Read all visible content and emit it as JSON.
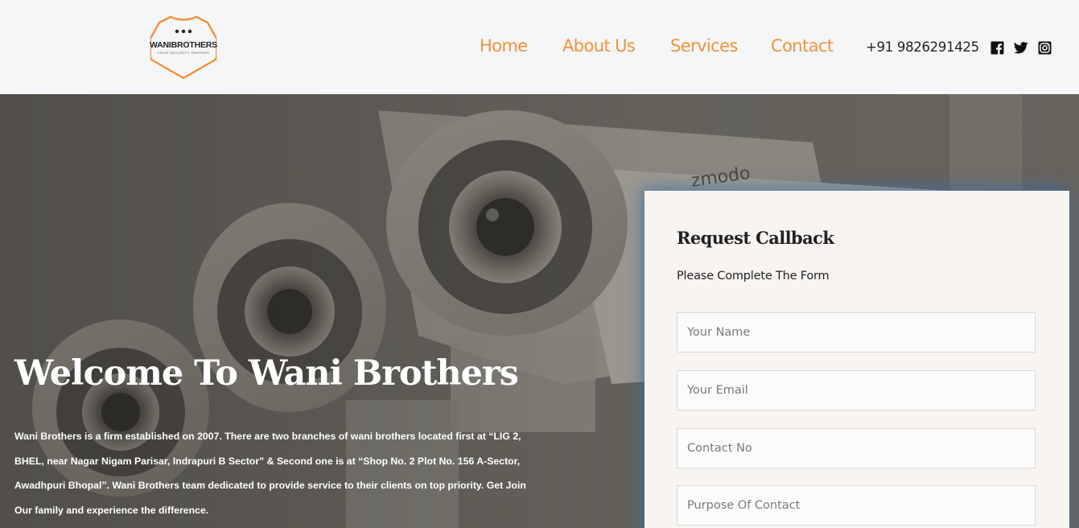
{
  "brand": {
    "name": "WANIBROTHERS",
    "tagline": "YOUR SECURITY PARTNER",
    "accent_color": "#f2913b"
  },
  "nav": {
    "items": [
      {
        "label": "Home"
      },
      {
        "label": "About Us"
      },
      {
        "label": "Services"
      },
      {
        "label": "Contact"
      }
    ],
    "phone": "+91 9826291425",
    "social_icons": [
      "facebook-icon",
      "twitter-icon",
      "instagram-icon"
    ]
  },
  "hero": {
    "title": "Welcome To Wani Brothers",
    "description": "Wani Brothers is a firm established on 2007. There are two branches of wani brothers located first at “LIG 2, BHEL, near Nagar Nigam Parisar, Indrapuri B Sector” & Second one is at “Shop No. 2 Plot No. 156 A-Sector, Awadhpuri Bhopal”. Wani Brothers team dedicated to provide service to their clients on top priority. Get Join Our family and experience the difference.",
    "camera_brand_text": "zmodo"
  },
  "callback_form": {
    "title": "Request Callback",
    "subtitle": "Please Complete The Form",
    "fields": [
      {
        "placeholder": "Your Name",
        "value": ""
      },
      {
        "placeholder": "Your Email",
        "value": ""
      },
      {
        "placeholder": "Contact No",
        "value": ""
      },
      {
        "placeholder": "Purpose Of Contact",
        "value": ""
      }
    ]
  }
}
